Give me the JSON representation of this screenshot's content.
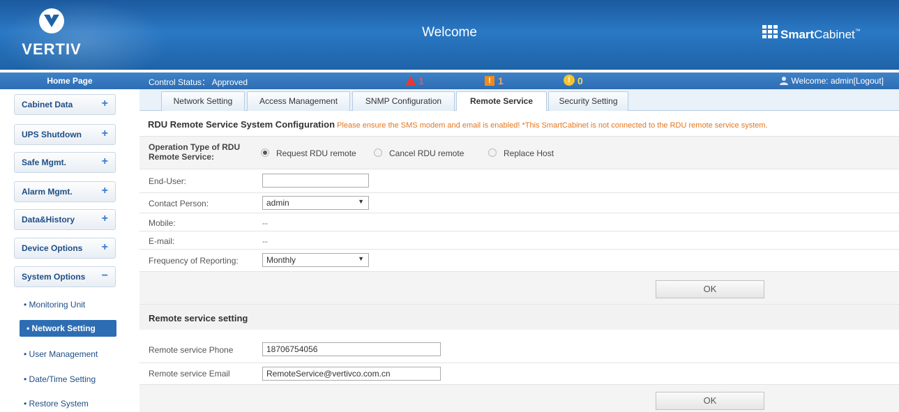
{
  "header": {
    "logo_text": "VERTIV",
    "title": "Welcome",
    "brand_bold": "Smart",
    "brand_rest": "Cabinet",
    "brand_tm": "™"
  },
  "statusbar": {
    "control_status": "Control Status：  Approved",
    "critical_count": "1",
    "major_count": "1",
    "minor_count": "0",
    "welcome": "Welcome: admin[Logout]"
  },
  "sidebar": {
    "home": "Home Page",
    "menus": [
      {
        "label": "Cabinet Data",
        "sign": "+"
      },
      {
        "label": "UPS Shutdown",
        "sign": "+"
      },
      {
        "label": "Safe Mgmt.",
        "sign": "+"
      },
      {
        "label": "Alarm Mgmt.",
        "sign": "+"
      },
      {
        "label": "Data&History",
        "sign": "+"
      },
      {
        "label": "Device Options",
        "sign": "+"
      },
      {
        "label": "System Options",
        "sign": "−"
      }
    ],
    "subitems": [
      "• Monitoring Unit",
      "• Network Setting",
      "• User Management",
      "• Date/Time Setting",
      "• Restore System"
    ]
  },
  "tabs": [
    "Network Setting",
    "Access Management",
    "SNMP Configuration",
    "Remote Service",
    "Security Setting"
  ],
  "section1": {
    "title": "RDU Remote Service System Configuration",
    "notice": " Please ensure the SMS modem and email is enabled! *This SmartCabinet is not connected to the RDU remote service system.",
    "op_label_1": "Operation Type of RDU",
    "op_label_2": "Remote Service:",
    "radio_options": [
      "Request RDU remote",
      "Cancel RDU remote",
      "Replace Host"
    ],
    "end_user_label": "End-User:",
    "end_user_value": "",
    "contact_label": "Contact Person:",
    "contact_value": "admin",
    "mobile_label": "Mobile:",
    "mobile_value": "--",
    "email_label": "E-mail:",
    "email_value": "--",
    "freq_label": "Frequency of Reporting:",
    "freq_value": "Monthly",
    "ok": "OK"
  },
  "section2": {
    "title": "Remote service setting",
    "phone_label": "Remote service Phone",
    "phone_value": "18706754056",
    "email_label": "Remote service Email",
    "email_value": "RemoteService@vertivco.com.cn",
    "ok": "OK"
  },
  "colors": {
    "header_blue": "#2a78c4",
    "accent_orange": "#e4761e",
    "critical": "#e53935",
    "major": "#f08a1c",
    "minor": "#f4c430"
  }
}
